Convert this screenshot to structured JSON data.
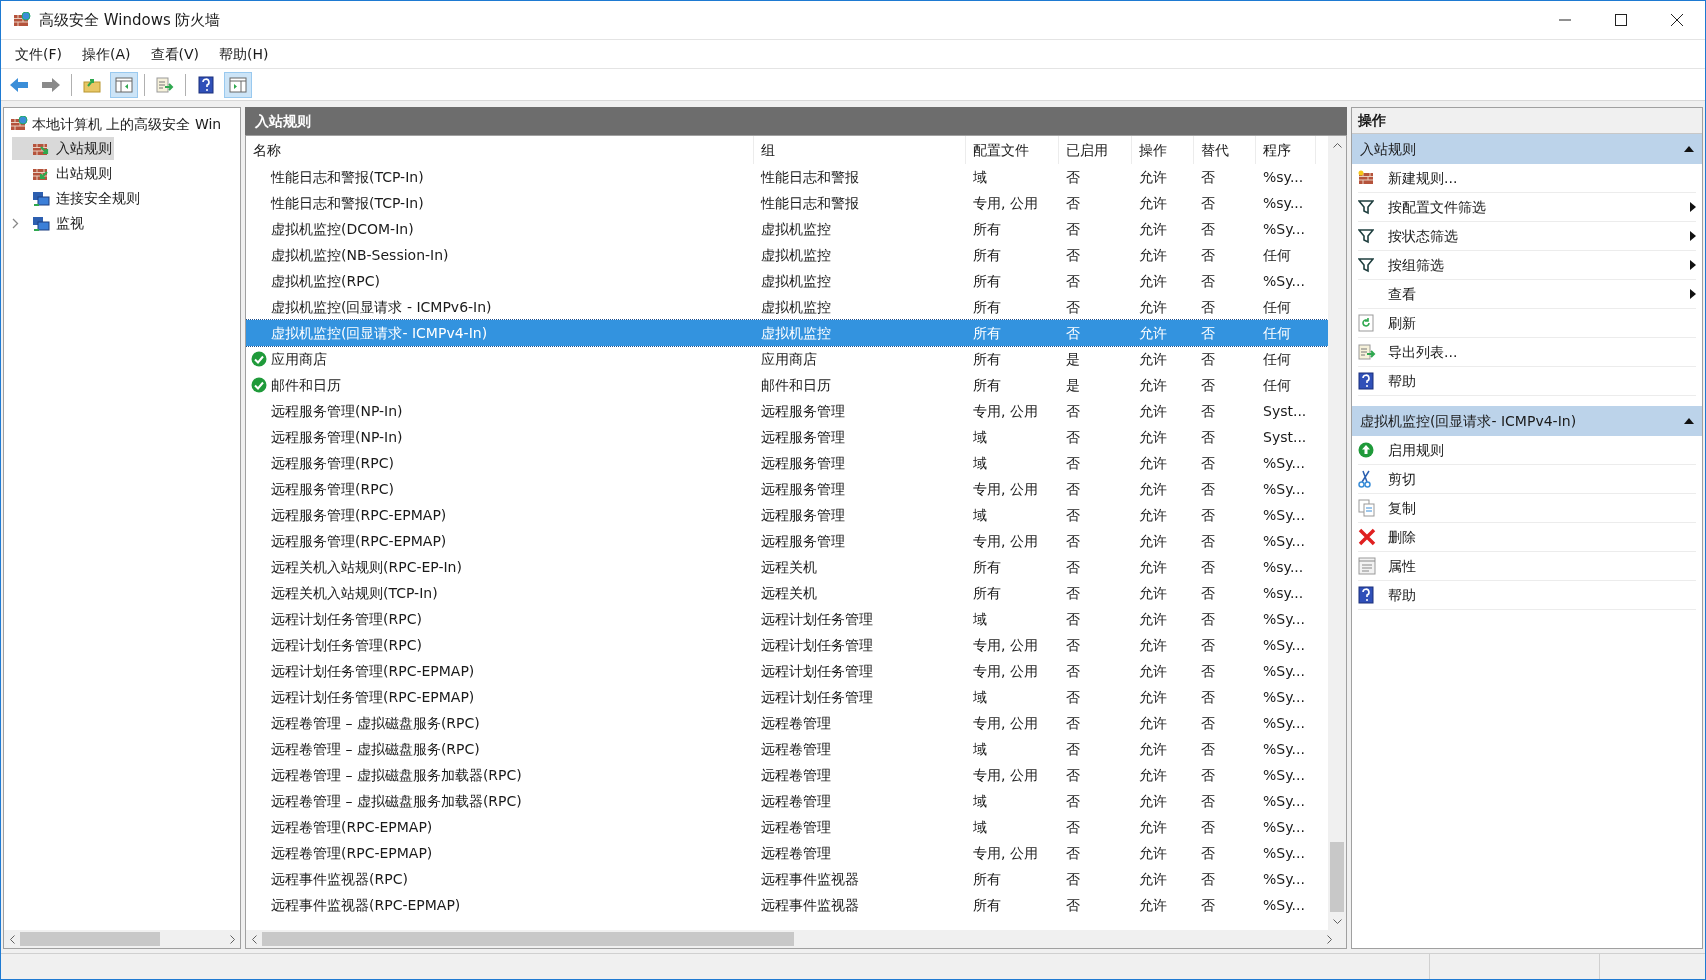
{
  "window": {
    "title": "高级安全 Windows 防火墙"
  },
  "menu": [
    "文件(F)",
    "操作(A)",
    "查看(V)",
    "帮助(H)"
  ],
  "toolbar": [
    {
      "kind": "back",
      "pressed": false
    },
    {
      "kind": "forward",
      "pressed": false
    },
    {
      "kind": "sep"
    },
    {
      "kind": "up",
      "pressed": false
    },
    {
      "kind": "tree",
      "pressed": true
    },
    {
      "kind": "sep"
    },
    {
      "kind": "export",
      "pressed": false
    },
    {
      "kind": "sep"
    },
    {
      "kind": "help",
      "pressed": false
    },
    {
      "kind": "pane",
      "pressed": true
    }
  ],
  "tree": {
    "label": "本地计算机 上的高级安全 Win",
    "children": [
      {
        "label": "入站规则",
        "kind": "inbound",
        "selected": true,
        "has_children": false
      },
      {
        "label": "出站规则",
        "kind": "outbound",
        "selected": false,
        "has_children": false
      },
      {
        "label": "连接安全规则",
        "kind": "connection",
        "selected": false,
        "has_children": false
      },
      {
        "label": "监视",
        "kind": "monitor",
        "selected": false,
        "has_children": true
      }
    ]
  },
  "table": {
    "title": "入站规则",
    "columns": [
      "名称",
      "组",
      "配置文件",
      "已启用",
      "操作",
      "替代",
      "程序"
    ],
    "rows": [
      {
        "cells": [
          "性能日志和警报(TCP-In)",
          "性能日志和警报",
          "域",
          "否",
          "允许",
          "否",
          "%sy..."
        ],
        "active": false,
        "selected": false
      },
      {
        "cells": [
          "性能日志和警报(TCP-In)",
          "性能日志和警报",
          "专用, 公用",
          "否",
          "允许",
          "否",
          "%sy..."
        ],
        "active": false,
        "selected": false
      },
      {
        "cells": [
          "虚拟机监控(DCOM-In)",
          "虚拟机监控",
          "所有",
          "否",
          "允许",
          "否",
          "%Sy..."
        ],
        "active": false,
        "selected": false
      },
      {
        "cells": [
          "虚拟机监控(NB-Session-In)",
          "虚拟机监控",
          "所有",
          "否",
          "允许",
          "否",
          "任何"
        ],
        "active": false,
        "selected": false
      },
      {
        "cells": [
          "虚拟机监控(RPC)",
          "虚拟机监控",
          "所有",
          "否",
          "允许",
          "否",
          "%Sy..."
        ],
        "active": false,
        "selected": false
      },
      {
        "cells": [
          "虚拟机监控(回显请求 - ICMPv6-In)",
          "虚拟机监控",
          "所有",
          "否",
          "允许",
          "否",
          "任何"
        ],
        "active": false,
        "selected": false
      },
      {
        "cells": [
          "虚拟机监控(回显请求- ICMPv4-In)",
          "虚拟机监控",
          "所有",
          "否",
          "允许",
          "否",
          "任何"
        ],
        "active": false,
        "selected": true
      },
      {
        "cells": [
          "应用商店",
          "应用商店",
          "所有",
          "是",
          "允许",
          "否",
          "任何"
        ],
        "active": true,
        "selected": false
      },
      {
        "cells": [
          "邮件和日历",
          "邮件和日历",
          "所有",
          "是",
          "允许",
          "否",
          "任何"
        ],
        "active": true,
        "selected": false
      },
      {
        "cells": [
          "远程服务管理(NP-In)",
          "远程服务管理",
          "专用, 公用",
          "否",
          "允许",
          "否",
          "Syst..."
        ],
        "active": false,
        "selected": false
      },
      {
        "cells": [
          "远程服务管理(NP-In)",
          "远程服务管理",
          "域",
          "否",
          "允许",
          "否",
          "Syst..."
        ],
        "active": false,
        "selected": false
      },
      {
        "cells": [
          "远程服务管理(RPC)",
          "远程服务管理",
          "域",
          "否",
          "允许",
          "否",
          "%Sy..."
        ],
        "active": false,
        "selected": false
      },
      {
        "cells": [
          "远程服务管理(RPC)",
          "远程服务管理",
          "专用, 公用",
          "否",
          "允许",
          "否",
          "%Sy..."
        ],
        "active": false,
        "selected": false
      },
      {
        "cells": [
          "远程服务管理(RPC-EPMAP)",
          "远程服务管理",
          "域",
          "否",
          "允许",
          "否",
          "%Sy..."
        ],
        "active": false,
        "selected": false
      },
      {
        "cells": [
          "远程服务管理(RPC-EPMAP)",
          "远程服务管理",
          "专用, 公用",
          "否",
          "允许",
          "否",
          "%Sy..."
        ],
        "active": false,
        "selected": false
      },
      {
        "cells": [
          "远程关机入站规则(RPC-EP-In)",
          "远程关机",
          "所有",
          "否",
          "允许",
          "否",
          "%sy..."
        ],
        "active": false,
        "selected": false
      },
      {
        "cells": [
          "远程关机入站规则(TCP-In)",
          "远程关机",
          "所有",
          "否",
          "允许",
          "否",
          "%sy..."
        ],
        "active": false,
        "selected": false
      },
      {
        "cells": [
          "远程计划任务管理(RPC)",
          "远程计划任务管理",
          "域",
          "否",
          "允许",
          "否",
          "%Sy..."
        ],
        "active": false,
        "selected": false
      },
      {
        "cells": [
          "远程计划任务管理(RPC)",
          "远程计划任务管理",
          "专用, 公用",
          "否",
          "允许",
          "否",
          "%Sy..."
        ],
        "active": false,
        "selected": false
      },
      {
        "cells": [
          "远程计划任务管理(RPC-EPMAP)",
          "远程计划任务管理",
          "专用, 公用",
          "否",
          "允许",
          "否",
          "%Sy..."
        ],
        "active": false,
        "selected": false
      },
      {
        "cells": [
          "远程计划任务管理(RPC-EPMAP)",
          "远程计划任务管理",
          "域",
          "否",
          "允许",
          "否",
          "%Sy..."
        ],
        "active": false,
        "selected": false
      },
      {
        "cells": [
          "远程卷管理 – 虚拟磁盘服务(RPC)",
          "远程卷管理",
          "专用, 公用",
          "否",
          "允许",
          "否",
          "%Sy..."
        ],
        "active": false,
        "selected": false
      },
      {
        "cells": [
          "远程卷管理 – 虚拟磁盘服务(RPC)",
          "远程卷管理",
          "域",
          "否",
          "允许",
          "否",
          "%Sy..."
        ],
        "active": false,
        "selected": false
      },
      {
        "cells": [
          "远程卷管理 – 虚拟磁盘服务加载器(RPC)",
          "远程卷管理",
          "专用, 公用",
          "否",
          "允许",
          "否",
          "%Sy..."
        ],
        "active": false,
        "selected": false
      },
      {
        "cells": [
          "远程卷管理 – 虚拟磁盘服务加载器(RPC)",
          "远程卷管理",
          "域",
          "否",
          "允许",
          "否",
          "%Sy..."
        ],
        "active": false,
        "selected": false
      },
      {
        "cells": [
          "远程卷管理(RPC-EPMAP)",
          "远程卷管理",
          "域",
          "否",
          "允许",
          "否",
          "%Sy..."
        ],
        "active": false,
        "selected": false
      },
      {
        "cells": [
          "远程卷管理(RPC-EPMAP)",
          "远程卷管理",
          "专用, 公用",
          "否",
          "允许",
          "否",
          "%Sy..."
        ],
        "active": false,
        "selected": false
      },
      {
        "cells": [
          "远程事件监视器(RPC)",
          "远程事件监视器",
          "所有",
          "否",
          "允许",
          "否",
          "%Sy..."
        ],
        "active": false,
        "selected": false
      },
      {
        "cells": [
          "远程事件监视器(RPC-EPMAP)",
          "远程事件监视器",
          "所有",
          "否",
          "允许",
          "否",
          "%Sy..."
        ],
        "active": false,
        "selected": false
      }
    ]
  },
  "actions": {
    "title": "操作",
    "sections": [
      {
        "title": "入站规则",
        "expanded": true,
        "items": [
          {
            "label": "新建规则...",
            "kind": "new-rule",
            "submenu": false
          },
          {
            "label": "按配置文件筛选",
            "kind": "filter",
            "submenu": true
          },
          {
            "label": "按状态筛选",
            "kind": "filter",
            "submenu": true
          },
          {
            "label": "按组筛选",
            "kind": "filter",
            "submenu": true
          },
          {
            "label": "查看",
            "kind": "none",
            "submenu": true
          },
          {
            "label": "刷新",
            "kind": "refresh",
            "submenu": false
          },
          {
            "label": "导出列表...",
            "kind": "export",
            "submenu": false
          },
          {
            "label": "帮助",
            "kind": "help",
            "submenu": false
          }
        ]
      },
      {
        "title": "虚拟机监控(回显请求- ICMPv4-In)",
        "expanded": true,
        "items": [
          {
            "label": "启用规则",
            "kind": "enable",
            "submenu": false
          },
          {
            "label": "剪切",
            "kind": "cut",
            "submenu": false
          },
          {
            "label": "复制",
            "kind": "copy",
            "submenu": false
          },
          {
            "label": "删除",
            "kind": "delete",
            "submenu": false
          },
          {
            "label": "属性",
            "kind": "properties",
            "submenu": false
          },
          {
            "label": "帮助",
            "kind": "help",
            "submenu": false
          }
        ]
      }
    ]
  }
}
